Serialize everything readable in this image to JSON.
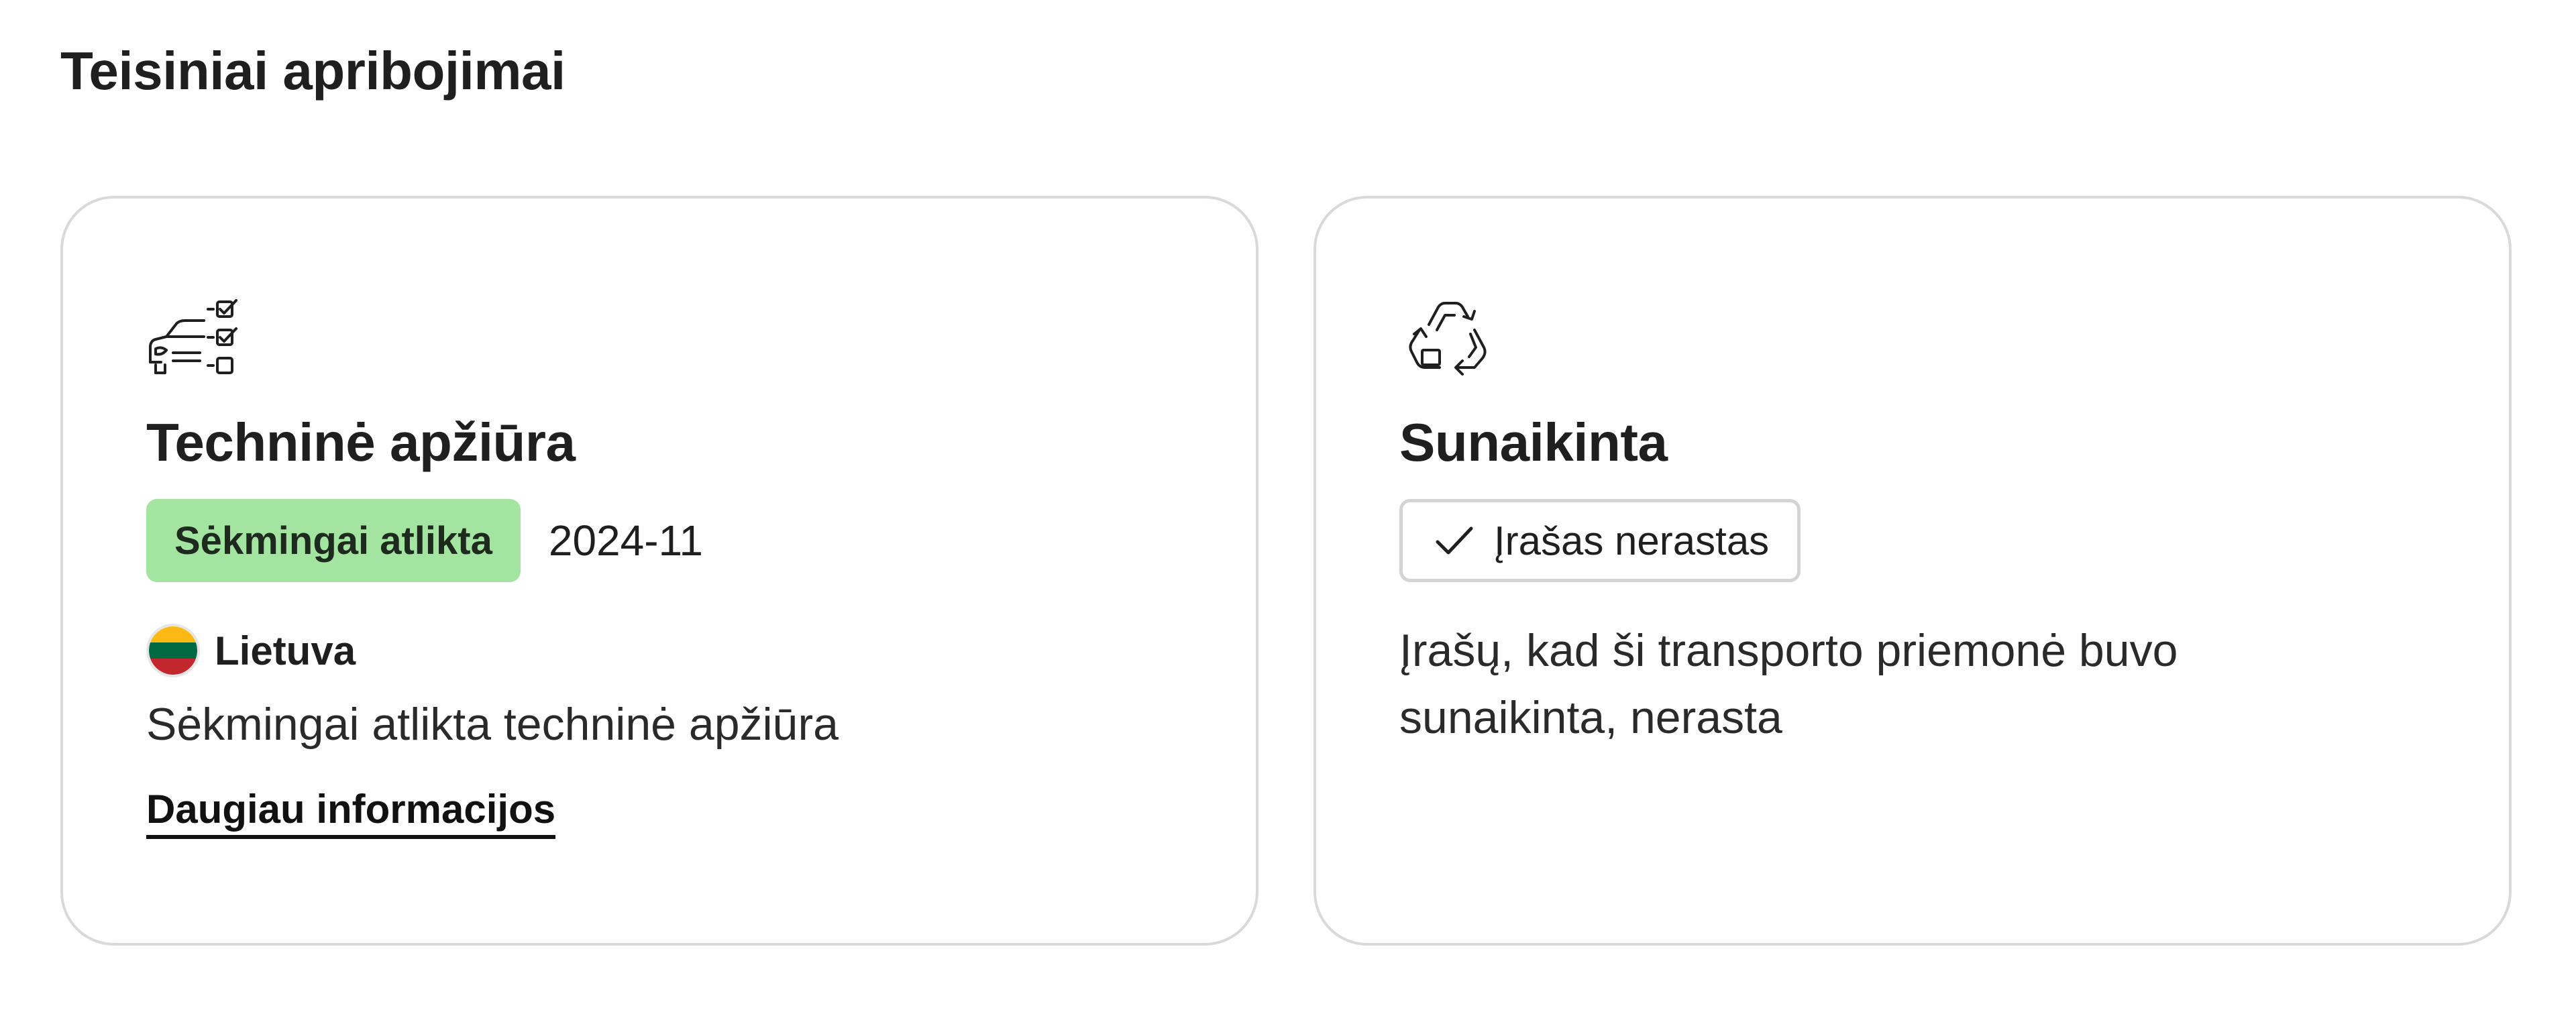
{
  "page": {
    "title": "Teisiniai apribojimai"
  },
  "inspection_card": {
    "icon": "car-checklist-icon",
    "title": "Techninė apžiūra",
    "status_badge": "Sėkmingai atlikta",
    "status_color": "#a3e4a0",
    "date": "2024-11",
    "country": {
      "name": "Lietuva",
      "flag_icon": "lithuania-flag-icon",
      "flag_colors": [
        "#fdb913",
        "#006a44",
        "#c1272d"
      ]
    },
    "description": "Sėkmingai atlikta techninė apžiūra",
    "more_link": "Daugiau informacijos"
  },
  "scrapped_card": {
    "icon": "recycle-icon",
    "title": "Sunaikinta",
    "status_badge": "Įrašas nerastas",
    "status_icon": "checkmark-icon",
    "description": "Įrašų, kad ši transporto priemonė buvo sunaikinta, nerasta"
  }
}
